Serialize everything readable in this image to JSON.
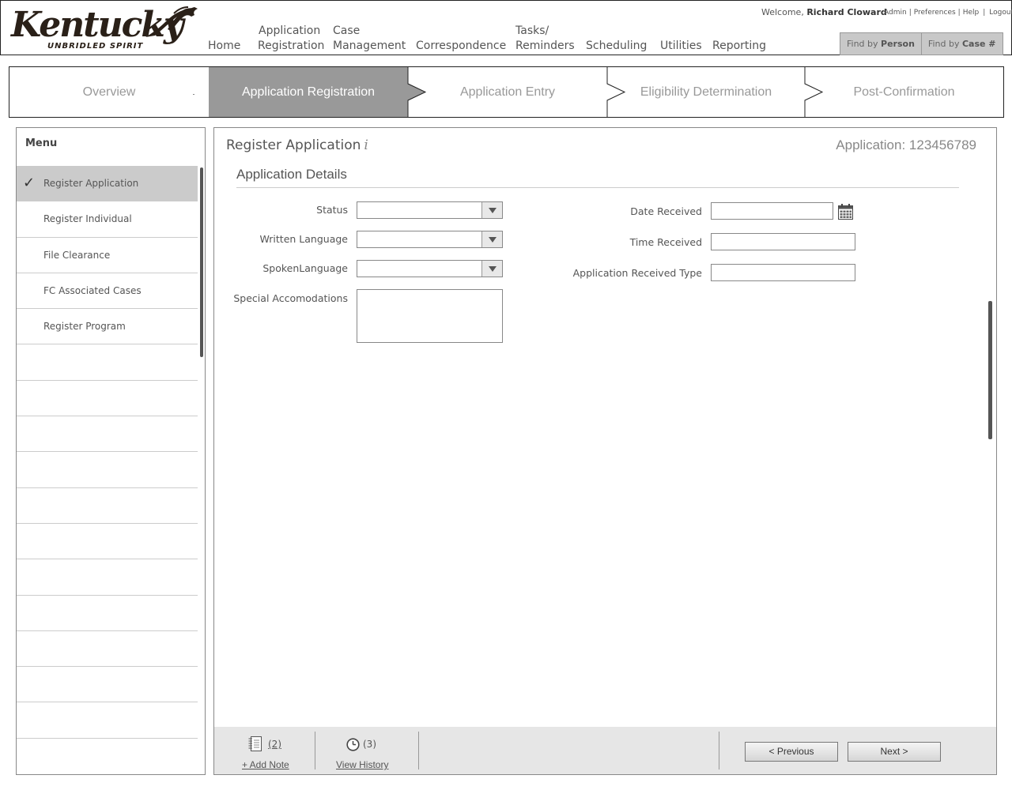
{
  "brand": {
    "logo_word": "Kentucky",
    "logo_tagline": "UNBRIDLED SPIRIT"
  },
  "nav": {
    "home": "Home",
    "app_reg_l1": "Application",
    "app_reg_l2": "Registration",
    "case_l1": "Case",
    "case_l2": "Management",
    "correspondence": "Correspondence",
    "tasks_l1": "Tasks/",
    "tasks_l2": "Reminders",
    "scheduling": "Scheduling",
    "utilities": "Utilities",
    "reporting": "Reporting"
  },
  "user": {
    "welcome_prefix": "Welcome,",
    "name": "Richard Cloward",
    "links": {
      "admin": "Admin",
      "preferences": "Preferences",
      "help": "Help",
      "logout": "Logout"
    },
    "sep": "|"
  },
  "find": {
    "by_person_prefix": "Find by",
    "by_person": "Person",
    "by_case_prefix": "Find by",
    "by_case": "Case #"
  },
  "steps": [
    {
      "label": "Overview",
      "active": false
    },
    {
      "label": "Application Registration",
      "active": true
    },
    {
      "label": "Application Entry",
      "active": false
    },
    {
      "label": "Eligibility Determination",
      "active": false
    },
    {
      "label": "Post-Confirmation",
      "active": false
    }
  ],
  "sidebar": {
    "title": "Menu",
    "check_icon": "checkmark-icon",
    "items": [
      {
        "label": "Register Application",
        "active": true
      },
      {
        "label": "Register Individual",
        "active": false
      },
      {
        "label": "File Clearance",
        "active": false
      },
      {
        "label": "FC Associated Cases",
        "active": false
      },
      {
        "label": "Register Program",
        "active": false
      }
    ],
    "empty_rows": 11
  },
  "main": {
    "title": "Register Application",
    "info_glyph": "i",
    "application_label": "Application: 123456789",
    "section": "Application Details",
    "fields": {
      "status": {
        "label": "Status",
        "value": ""
      },
      "written_language": {
        "label": "Written Language",
        "value": ""
      },
      "spoken_language": {
        "label": "SpokenLanguage",
        "value": ""
      },
      "special_accommodations": {
        "label": "Special Accomodations",
        "value": ""
      },
      "date_received": {
        "label": "Date Received",
        "value": ""
      },
      "time_received": {
        "label": "Time Received",
        "value": ""
      },
      "application_received_type": {
        "label": "Application Received Type",
        "value": ""
      }
    }
  },
  "footer": {
    "notes_count": "(2)",
    "add_note": "+ Add Note",
    "history_count": "(3)",
    "view_history": "View History",
    "previous": "< Previous",
    "next": "Next >"
  },
  "colors": {
    "active_step": "#999999",
    "active_menu": "#cbcbcb",
    "footer_bg": "#e6e6e6"
  }
}
